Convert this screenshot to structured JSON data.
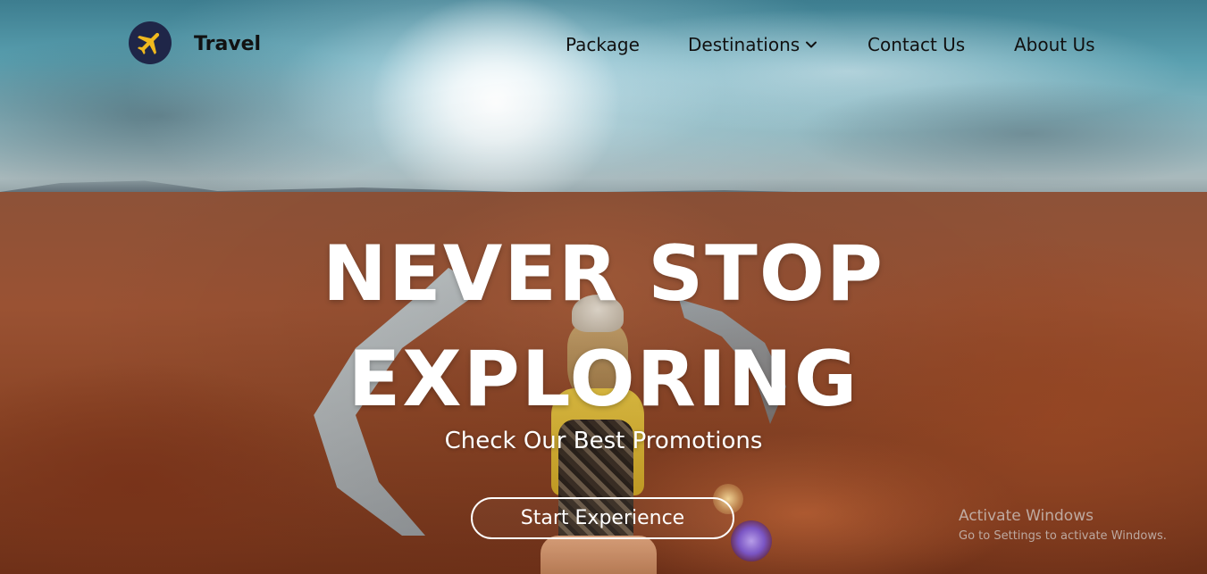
{
  "nav": {
    "brand": "Travel",
    "logo_icon": "airplane-icon",
    "links": [
      {
        "label": "Package"
      },
      {
        "label": "Destinations",
        "icon": "chevron-down-icon"
      },
      {
        "label": "Contact Us"
      },
      {
        "label": "About Us"
      }
    ]
  },
  "hero": {
    "headline_line1": "NEVER STOP",
    "headline_line2": "EXPLORING",
    "subtitle": "Check Our Best Promotions",
    "cta_label": "Start Experience"
  },
  "watermark": {
    "title": "Activate Windows",
    "subtitle": "Go to Settings to activate Windows."
  },
  "colors": {
    "logo_bg": "#1f2648",
    "logo_plane": "#f0b91e",
    "nav_text": "#111111",
    "hero_text": "#ffffff"
  }
}
